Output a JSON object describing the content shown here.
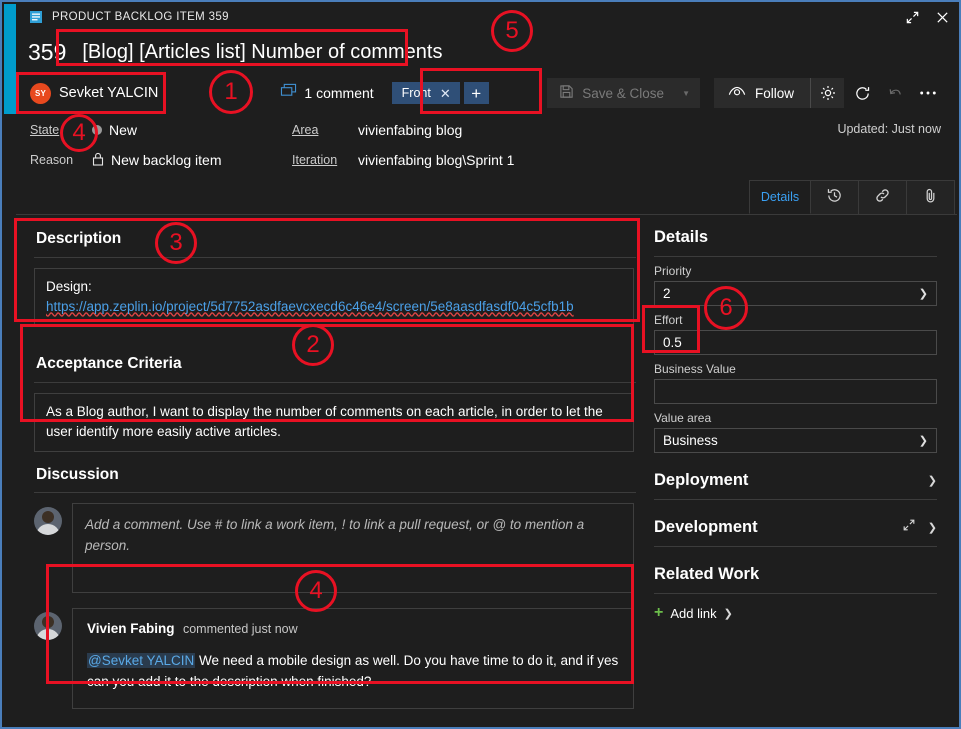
{
  "window": {
    "titlebar_text": "PRODUCT BACKLOG ITEM 359",
    "titlebar_icon": "work-item-icon",
    "maximize_icon": "expand-icon",
    "close_icon": "close-icon"
  },
  "header": {
    "work_item_id": "359",
    "title": "[Blog] [Articles list] Number of comments",
    "assignee": {
      "initials": "SY",
      "name": "Sevket YALCIN",
      "avatar_color": "#e8491e"
    },
    "comment_count_label": "1 comment",
    "comment_icon": "comment-bubble-icon",
    "tags": [
      {
        "label": "Front",
        "remove_icon": "close-icon"
      }
    ],
    "add_tag_label": "+",
    "toolbar": {
      "save_close_label": "Save & Close",
      "save_icon": "save-disk-icon",
      "save_dropdown_icon": "caret-down-icon",
      "follow_label": "Follow",
      "follow_icon": "eye-icon",
      "settings_icon": "gear-icon",
      "refresh_icon": "refresh-icon",
      "undo_icon": "undo-icon",
      "more_icon": "ellipsis-icon"
    }
  },
  "fields": {
    "state_label": "State",
    "state_value": "New",
    "state_icon": "state-dot-icon",
    "reason_label": "Reason",
    "reason_value": "New backlog item",
    "reason_icon": "lock-icon",
    "area_label": "Area",
    "area_value": "vivienfabing blog",
    "iteration_label": "Iteration",
    "iteration_value": "vivienfabing blog\\Sprint 1",
    "updated_text": "Updated: Just now"
  },
  "tabs": [
    {
      "label": "Details",
      "icon": "",
      "active": true
    },
    {
      "label": "",
      "icon": "history-icon",
      "active": false
    },
    {
      "label": "",
      "icon": "link-icon",
      "active": false
    },
    {
      "label": "",
      "icon": "paperclip-icon",
      "active": false
    }
  ],
  "description": {
    "heading": "Description",
    "line1": "Design:",
    "link_text": "https://app.zeplin.io/project/5d7752asdfaevcxecd6c46e4/screen/5e8aasdfasdf04c5cfb1b"
  },
  "acceptance_criteria": {
    "heading": "Acceptance Criteria",
    "text": "As a Blog author, I want to display the number of comments on each article, in order to let the user identify more easily active articles."
  },
  "discussion": {
    "heading": "Discussion",
    "comment_placeholder": "Add a comment. Use # to link a work item, ! to link a pull request, or @ to mention a person.",
    "comments": [
      {
        "author": "Vivien Fabing",
        "meta": "commented just now",
        "mention": "@Sevket YALCIN",
        "text": " We need a mobile design as well. Do you have time to do it, and if yes can you add it to the description when finished?"
      }
    ]
  },
  "details_panel": {
    "heading": "Details",
    "fields": [
      {
        "label": "Priority",
        "value": "2",
        "type": "select"
      },
      {
        "label": "Effort",
        "value": "0.5",
        "type": "text"
      },
      {
        "label": "Business Value",
        "value": "",
        "type": "text"
      },
      {
        "label": "Value area",
        "value": "Business",
        "type": "select"
      }
    ],
    "sections": [
      {
        "label": "Deployment",
        "expand_icon": "",
        "chevron_icon": "chevron-down-icon"
      },
      {
        "label": "Development",
        "expand_icon": "expand-icon",
        "chevron_icon": "chevron-down-icon"
      }
    ],
    "related_work": {
      "heading": "Related Work",
      "add_link_label": "Add link",
      "add_icon": "plus-icon",
      "chevron_icon": "chevron-down-icon"
    }
  },
  "annotations": [
    {
      "number": "1"
    },
    {
      "number": "2"
    },
    {
      "number": "3"
    },
    {
      "number": "4"
    },
    {
      "number": "4"
    },
    {
      "number": "5"
    },
    {
      "number": "6"
    }
  ],
  "colors": {
    "accent_blue": "#009ccc",
    "window_border": "#4a7ebb",
    "link_blue": "#4ba0e8",
    "tag_blue": "#2f4f77",
    "annotation_red": "#e81123",
    "avatar_orange": "#e8491e",
    "add_link_green": "#6cbf4b",
    "active_tab_blue": "#3aa0f3"
  }
}
